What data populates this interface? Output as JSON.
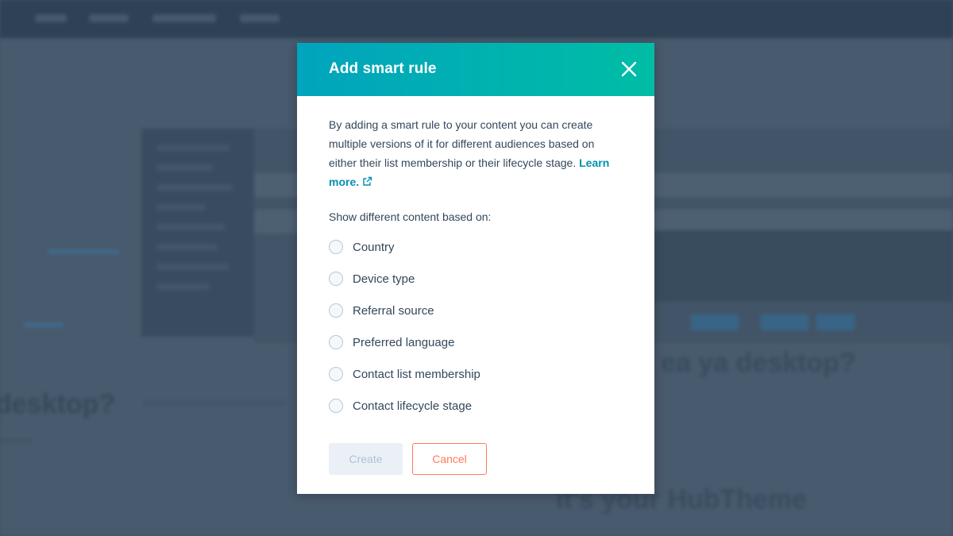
{
  "modal": {
    "title": "Add smart rule",
    "description": "By adding a smart rule to your content you can create multiple versions of it for different audiences based on either their list membership or their lifecycle stage.",
    "learn_more": "Learn more.",
    "section_label": "Show different content based on:",
    "options": [
      {
        "label": "Country",
        "selected": false
      },
      {
        "label": "Device type",
        "selected": false
      },
      {
        "label": "Referral source",
        "selected": false
      },
      {
        "label": "Preferred language",
        "selected": false
      },
      {
        "label": "Contact list membership",
        "selected": false
      },
      {
        "label": "Contact lifecycle stage",
        "selected": false
      }
    ],
    "create_label": "Create",
    "cancel_label": "Cancel",
    "create_disabled": true
  },
  "icons": {
    "close": "close-icon",
    "external_link": "external-link-icon"
  },
  "colors": {
    "header_gradient_start": "#00a4bd",
    "header_gradient_end": "#00bda5",
    "link": "#0091ae",
    "cancel_accent": "#ff7a59",
    "text": "#33475b"
  }
}
